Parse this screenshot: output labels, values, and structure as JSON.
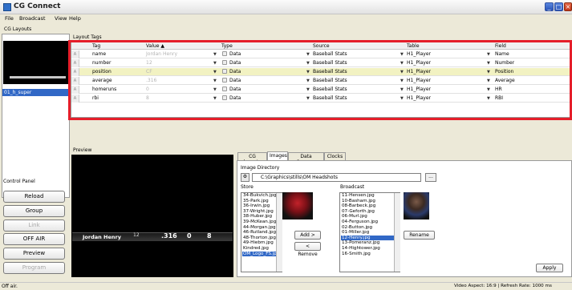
{
  "window": {
    "title": "CG Connect"
  },
  "menu": {
    "file": "File",
    "broadcast": "Broadcast",
    "view": "View",
    "help": "Help"
  },
  "layouts": {
    "label": "CG Layouts",
    "selected": "01_h_super"
  },
  "layout_tags_label": "Layout Tags",
  "grid": {
    "headers": [
      "Tag",
      "Value ▲",
      "Type",
      "Source",
      "Table",
      "Field"
    ],
    "rows": [
      {
        "tag": "name",
        "value": "Jordan Henry",
        "type": "Data",
        "source": "Baseball Stats",
        "table": "H1_Player",
        "field": "Name"
      },
      {
        "tag": "number",
        "value": "12",
        "type": "Data",
        "source": "Baseball Stats",
        "table": "H1_Player",
        "field": "Number"
      },
      {
        "tag": "position",
        "value": "CF",
        "type": "Data",
        "source": "Baseball Stats",
        "table": "H1_Player",
        "field": "Position"
      },
      {
        "tag": "average",
        "value": ".316",
        "type": "Data",
        "source": "Baseball Stats",
        "table": "H1_Player",
        "field": "Average"
      },
      {
        "tag": "homeruns",
        "value": "0",
        "type": "Data",
        "source": "Baseball Stats",
        "table": "H1_Player",
        "field": "HR"
      },
      {
        "tag": "rbi",
        "value": "8",
        "type": "Data",
        "source": "Baseball Stats",
        "table": "H1_Player",
        "field": "RBI"
      }
    ]
  },
  "preview": {
    "label": "Preview",
    "name": "Jordan Henry",
    "number": "12",
    "average": ".316",
    "hr": "0",
    "rbi": "8"
  },
  "control_panel": {
    "label": "Control Panel",
    "buttons": [
      "Reload",
      "Group",
      "Link",
      "OFF AIR",
      "Preview",
      "Program"
    ]
  },
  "tabs": [
    "CG layouts",
    "Images",
    "Data Sources",
    "Clocks"
  ],
  "images": {
    "dir_label": "Image Directory",
    "dir_value": "C:\\Graphics\\stills\\OM Headshots",
    "browse": "...",
    "store_label": "Store",
    "broadcast_label": "Broadcast",
    "store_items": [
      "34-Bukvich.jpg",
      "35-Park.jpg",
      "36-Irwin.jpg",
      "37-Wright.jpg",
      "38-Huber.jpg",
      "39-McKean.jpg",
      "44-Morgan.jpg",
      "46-Rutland.jpg",
      "48-Thorton.jpg",
      "49-Hiebm.jpg",
      "Kindred.jpg",
      "OM_Logo_FS.jpg"
    ],
    "store_selected": 11,
    "broadcast_items": [
      "11-Hensen.jpg",
      "10-Basham.jpg",
      "08-Barbeck.jpg",
      "07-Geforth.jpg",
      "06-Murl.jpg",
      "04-Ferguson.jpg",
      "02-Button.jpg",
      "01-Miller.jpg",
      "12-Henry.jpg",
      "13-Pomeranz.jpg",
      "14-Hightower.jpg",
      "16-Smith.jpg"
    ],
    "broadcast_selected": 8,
    "add": "Add >",
    "remove": "< Remove",
    "rename": "Rename",
    "apply": "Apply"
  },
  "status": {
    "left": "Off air.",
    "right": "Video Aspect: 16:9 | Refresh Rate: 1000 ms"
  }
}
